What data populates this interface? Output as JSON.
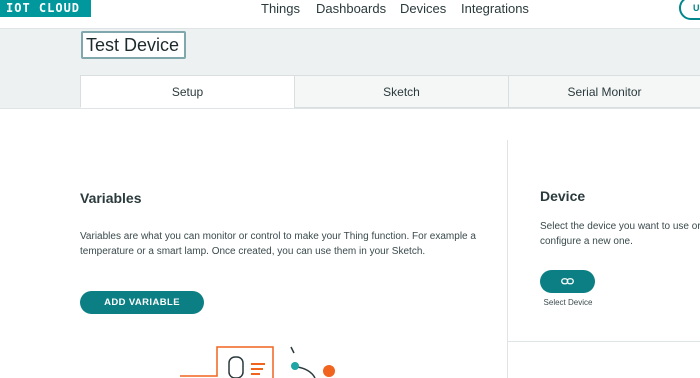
{
  "app": {
    "logo_text": "IOT CLOUD"
  },
  "nav": {
    "things": "Things",
    "dashboards": "Dashboards",
    "devices": "Devices",
    "integrations": "Integrations",
    "user_initial": "U"
  },
  "thing": {
    "name": "Test Device"
  },
  "tabs": [
    {
      "label": "Setup",
      "active": true
    },
    {
      "label": "Sketch",
      "active": false
    },
    {
      "label": "Serial Monitor",
      "active": false
    }
  ],
  "variables": {
    "title": "Variables",
    "description_line1": "Variables are what you can monitor or control to make your Thing function. For example a",
    "description_line2": "temperature or a smart lamp. Once created, you can use them in your Sketch.",
    "add_button": "ADD VARIABLE"
  },
  "device": {
    "title": "Device",
    "description_line1": "Select the device you want to use or",
    "description_line2": "configure a new one.",
    "select_label": "Select Device",
    "select_icon": "link-icon"
  },
  "colors": {
    "brand": "#00979d",
    "button": "#0b7f84",
    "illustration_orange": "#f0641e",
    "illustration_teal": "#1fa5a3"
  }
}
